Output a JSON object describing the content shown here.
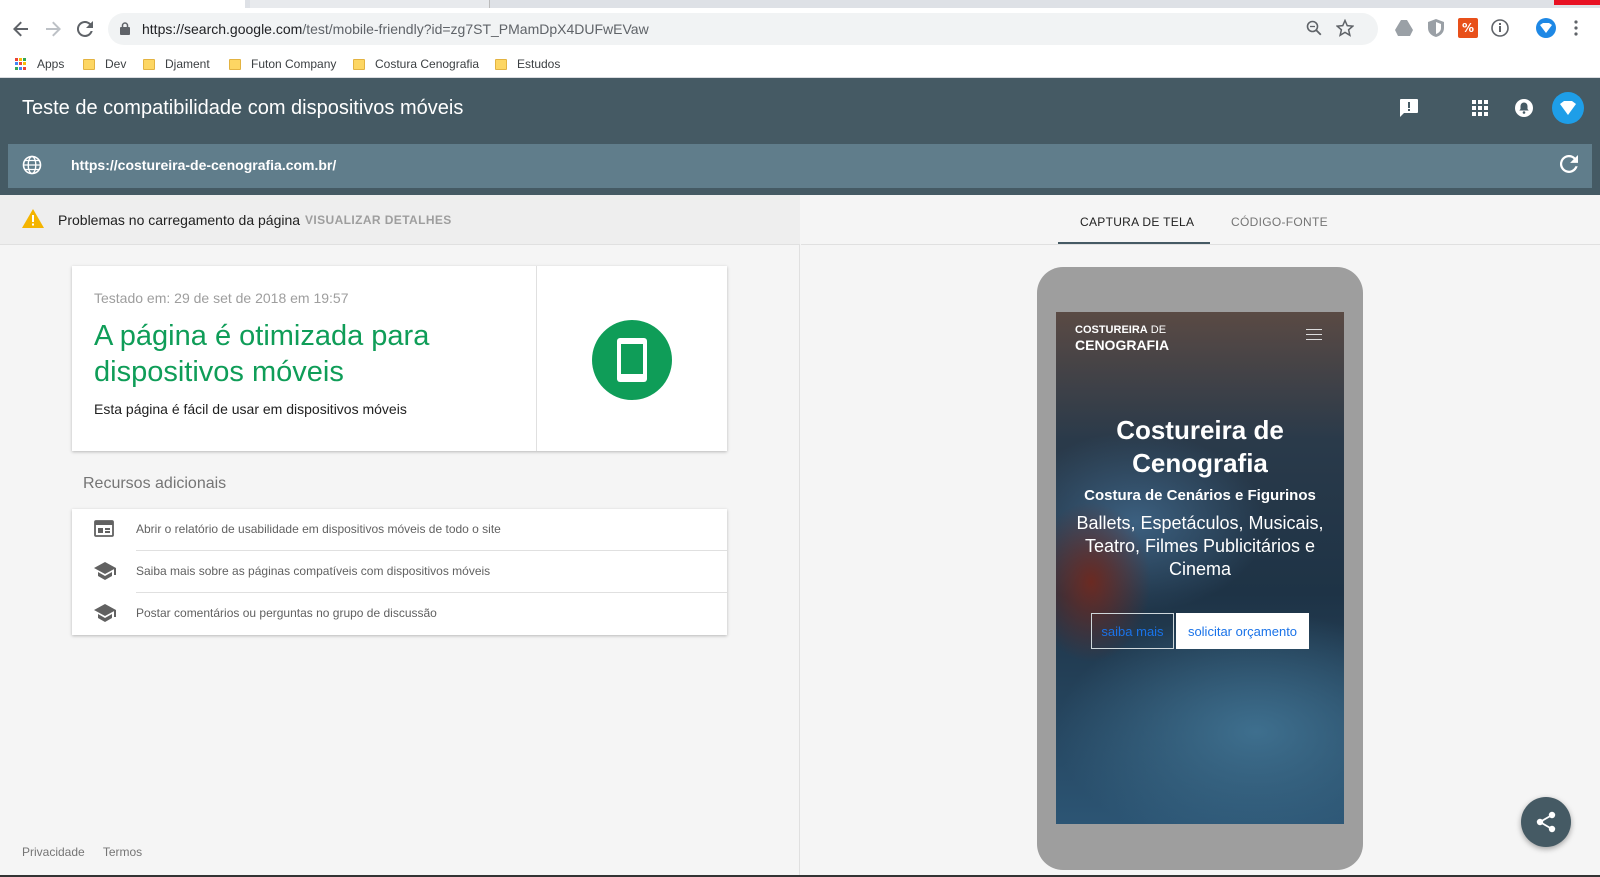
{
  "browser": {
    "url_host": "https://search.google.com",
    "url_path": "/test/mobile-friendly?id=zg7ST_PMamDpX4DUFwEVaw",
    "bookmarks": [
      "Apps",
      "Dev",
      "Djament",
      "Futon Company",
      "Costura Cenografia",
      "Estudos"
    ]
  },
  "header": {
    "title": "Teste de compatibilidade com dispositivos móveis",
    "tested_url": "https://costureira-de-cenografia.com.br/"
  },
  "warning": {
    "text": "Problemas no carregamento da página",
    "link": "VISUALIZAR DETALHES"
  },
  "result": {
    "tested_at": "Testado em: 29 de set de 2018 em 19:57",
    "headline": "A página é otimizada para dispositivos móveis",
    "subtitle": "Esta página é fácil de usar em dispositivos móveis"
  },
  "resources": {
    "title": "Recursos adicionais",
    "items": [
      "Abrir o relatório de usabilidade em dispositivos móveis de todo o site",
      "Saiba mais sobre as páginas compatíveis com dispositivos móveis",
      "Postar comentários ou perguntas no grupo de discussão"
    ]
  },
  "footer": {
    "privacy": "Privacidade",
    "terms": "Termos"
  },
  "tabs": [
    "CAPTURA DE TELA",
    "CÓDIGO-FONTE"
  ],
  "preview": {
    "logo_line1_bold": "COSTUREIRA",
    "logo_line1_light": " DE",
    "logo_line2": "CENOGRAFIA",
    "heading": "Costureira de Cenografia",
    "subheading": "Costura de Cenários e Figurinos",
    "description": "Ballets, Espetáculos, Musicais, Teatro, Filmes Publicitários e Cinema",
    "button_more": "saiba mais",
    "button_quote": "solicitar orçamento"
  },
  "colors": {
    "header_bg": "#455a64",
    "urlbar_bg": "#607d8b",
    "success_green": "#0f9d58",
    "warning_amber": "#f4b400"
  }
}
